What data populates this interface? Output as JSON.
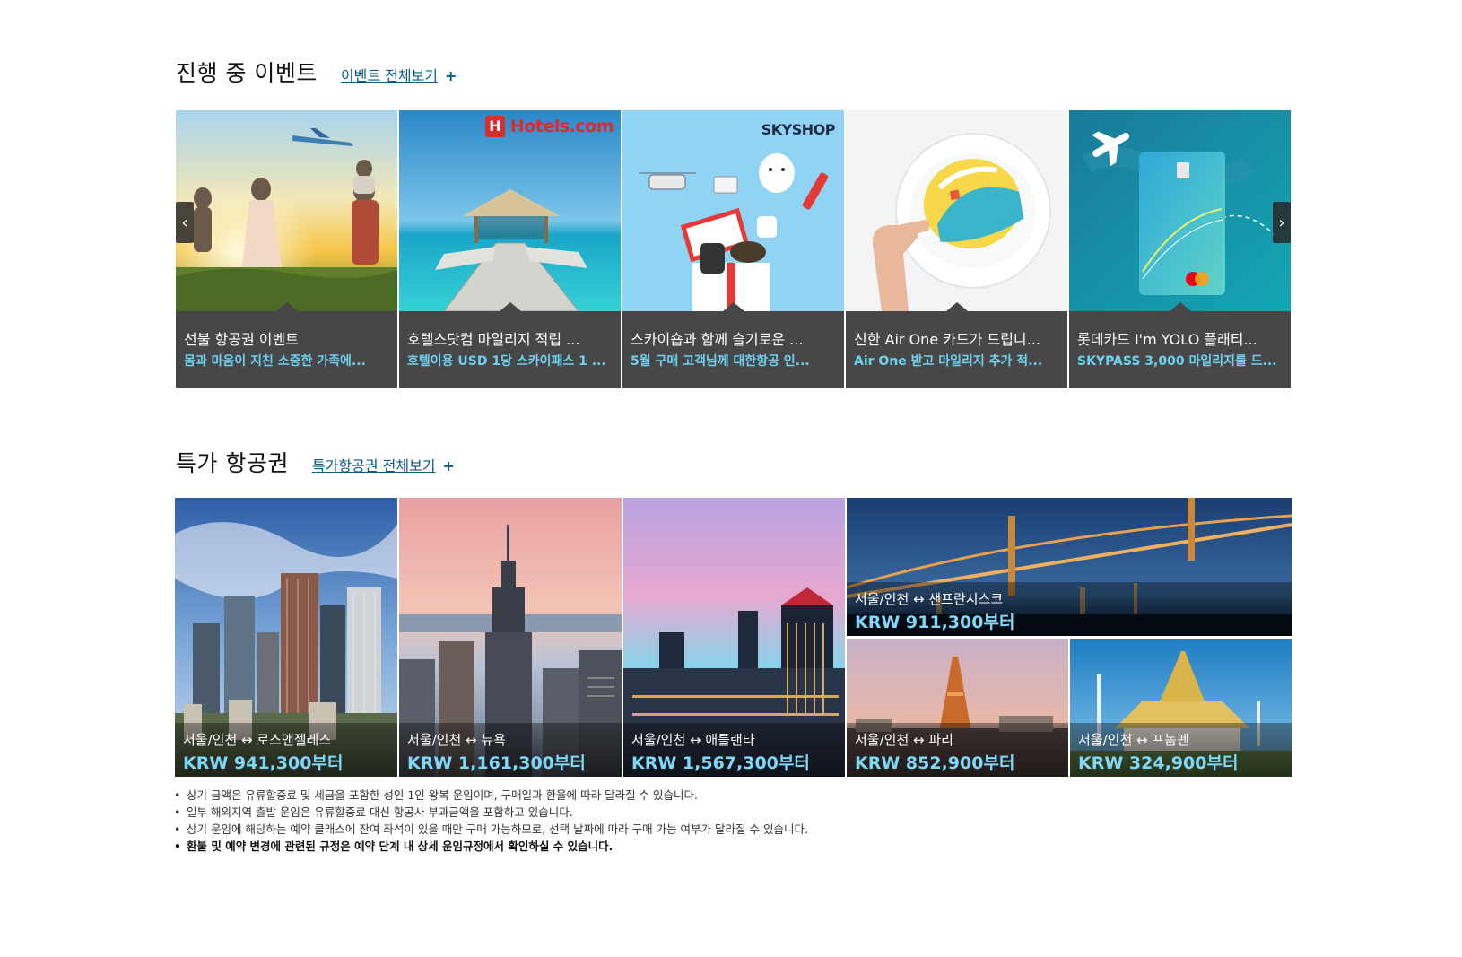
{
  "events_section": {
    "title": "진행 중 이벤트",
    "link": "이벤트 전체보기",
    "link_plus": "+",
    "cards": [
      {
        "title": "선불 항공권 이벤트",
        "subtitle": "몸과 마음이 지친 소중한 가족에...",
        "icon": "family-airplane-image"
      },
      {
        "title": "호텔스닷컴 마일리지 적립 ...",
        "subtitle": "호텔이용 USD 1당 스카이패스 1 ...",
        "brand": "Hotels.com",
        "icon": "hotels-dock-image"
      },
      {
        "title": "스카이숍과 함께 슬기로운 ...",
        "subtitle": "5월 구매 고객님께 대한항공 인...",
        "brand": "SKYSHOP",
        "icon": "skyshop-gift-image"
      },
      {
        "title": "신한 Air One 카드가 드립니...",
        "subtitle": "Air One 받고 마일리지 추가 적...",
        "icon": "card-plate-image"
      },
      {
        "title": "롯데카드 I'm YOLO 플래티...",
        "subtitle": "SKYPASS 3,000 마일리지를 드...",
        "icon": "lotte-card-image"
      }
    ],
    "prev_icon": "chevron-left-icon",
    "next_icon": "chevron-right-icon"
  },
  "fares_section": {
    "title": "특가 항공권",
    "link": "특가항공권 전체보기",
    "link_plus": "+",
    "fares": [
      {
        "route": "서울/인천 ↔ 로스앤젤레스",
        "price": "KRW 941,300부터"
      },
      {
        "route": "서울/인천 ↔ 뉴욕",
        "price": "KRW 1,161,300부터"
      },
      {
        "route": "서울/인천 ↔ 애틀랜타",
        "price": "KRW 1,567,300부터"
      },
      {
        "route": "서울/인천 ↔ 샌프란시스코",
        "price": "KRW 911,300부터"
      },
      {
        "route": "서울/인천 ↔ 파리",
        "price": "KRW 852,900부터"
      },
      {
        "route": "서울/인천 ↔ 프놈펜",
        "price": "KRW 324,900부터"
      }
    ]
  },
  "notes": [
    "상기 금액은 유류할증료 및 세금을 포함한 성인 1인 왕복 운임이며, 구매일과 환율에 따라 달라질 수 있습니다.",
    "일부 해외지역 출발 운임은 유류할증료 대신 항공사 부과금액을 포함하고 있습니다.",
    "상기 운임에 해당하는 예약 클래스에 잔여 좌석이 있을 때만 구매 가능하므로, 선택 날짜에 따라 구매 가능 여부가 달라질 수 있습니다.",
    "환불 및 예약 변경에 관련된 규정은 예약 단계 내 상세 운임규정에서 확인하실 수 있습니다."
  ],
  "colors": {
    "caption_bg": "#474747",
    "caption_sub": "#6fd0f0",
    "price": "#7fd8f7",
    "link": "#0b5a85"
  }
}
